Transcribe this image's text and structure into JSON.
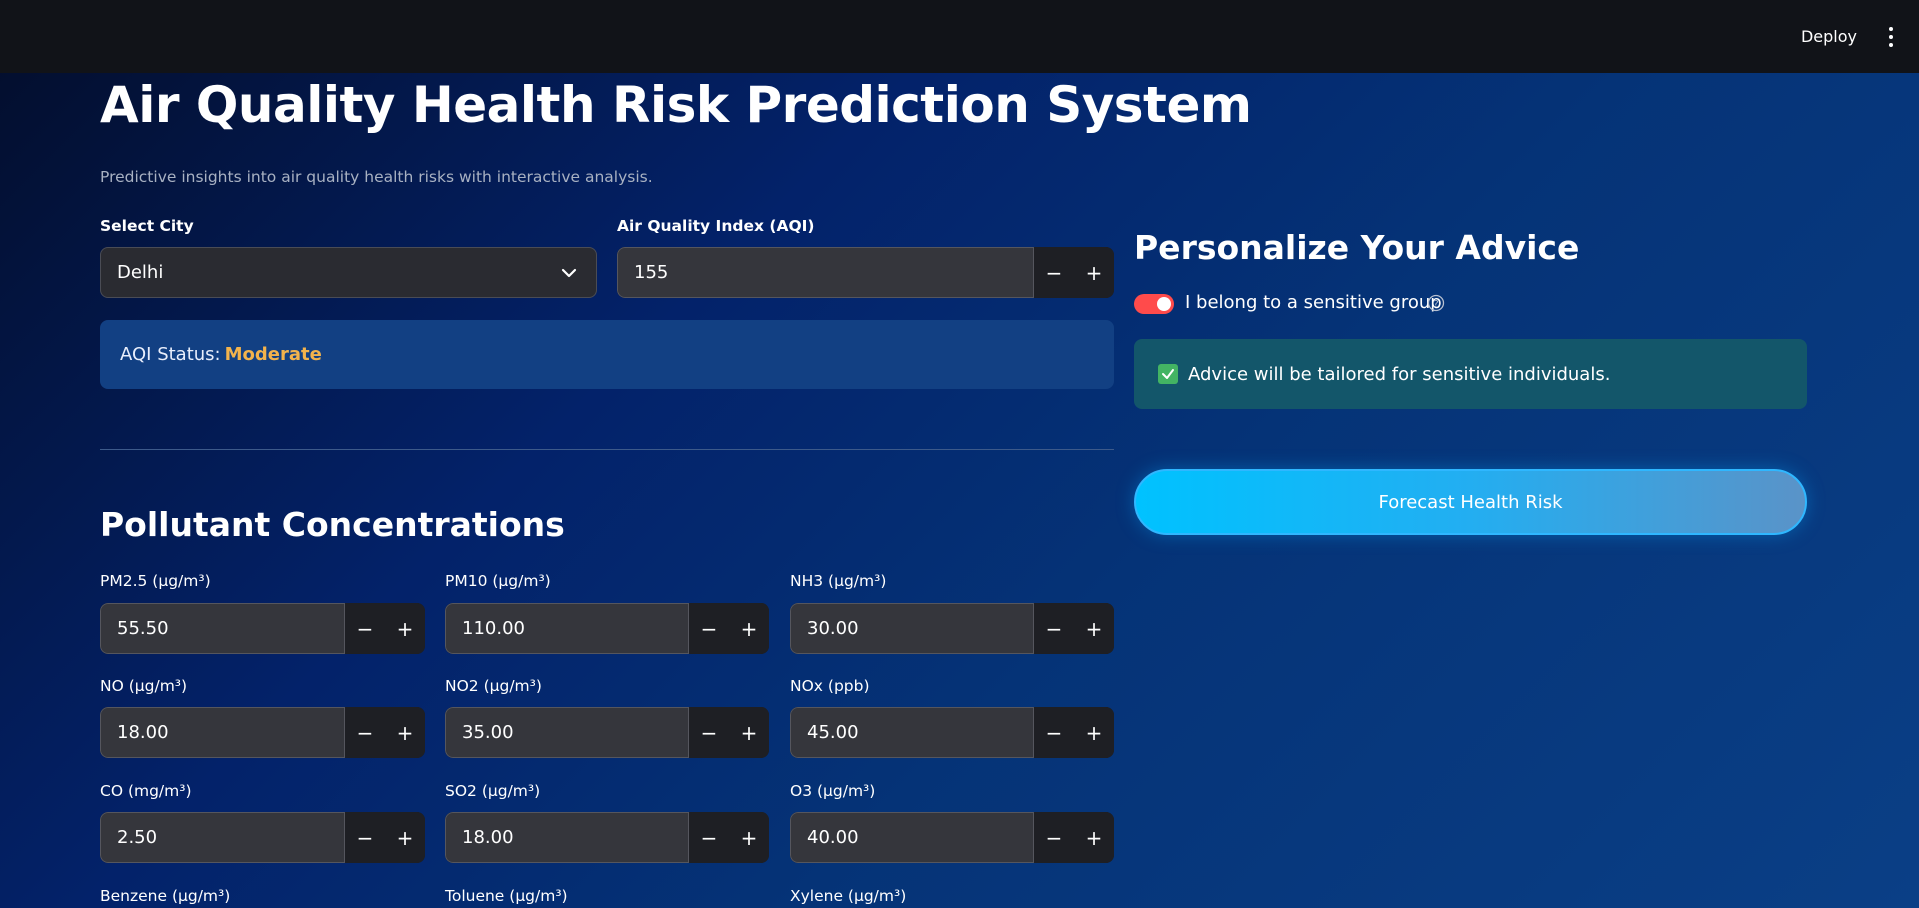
{
  "topbar": {
    "deploy_label": "Deploy",
    "menu_icon": "kebab-menu-icon"
  },
  "header": {
    "title": "Air Quality Health Risk Prediction System",
    "subtitle": "Predictive insights into air quality health risks with interactive analysis."
  },
  "city": {
    "label": "Select City",
    "value": "Delhi"
  },
  "aqi": {
    "label": "Air Quality Index (AQI)",
    "value": "155"
  },
  "aqi_status": {
    "label": "AQI Status:",
    "value": "Moderate",
    "color": "#f3b34c"
  },
  "pollutants": {
    "title": "Pollutant Concentrations",
    "items": [
      {
        "label": "PM2.5 (µg/m³)",
        "value": "55.50"
      },
      {
        "label": "PM10 (µg/m³)",
        "value": "110.00"
      },
      {
        "label": "NH3 (µg/m³)",
        "value": "30.00"
      },
      {
        "label": "NO (µg/m³)",
        "value": "18.00"
      },
      {
        "label": "NO2 (µg/m³)",
        "value": "35.00"
      },
      {
        "label": "NOx (ppb)",
        "value": "45.00"
      },
      {
        "label": "CO (mg/m³)",
        "value": "2.50"
      },
      {
        "label": "SO2 (µg/m³)",
        "value": "18.00"
      },
      {
        "label": "O3 (µg/m³)",
        "value": "40.00"
      },
      {
        "label": "Benzene (µg/m³)"
      },
      {
        "label": "Toluene (µg/m³)"
      },
      {
        "label": "Xylene (µg/m³)"
      }
    ]
  },
  "stepper": {
    "minus": "−",
    "plus": "+"
  },
  "advice": {
    "title": "Personalize Your Advice",
    "toggle_label": "I belong to a sensitive group",
    "toggle_on": true,
    "info_text": "Advice will be tailored for sensitive individuals.",
    "forecast_button": "Forecast Health Risk"
  },
  "colors": {
    "toggle": "#ff4b4b",
    "status_moderate": "#f3b34c",
    "info_bg": "#13566a",
    "button": "#00c2ff"
  }
}
